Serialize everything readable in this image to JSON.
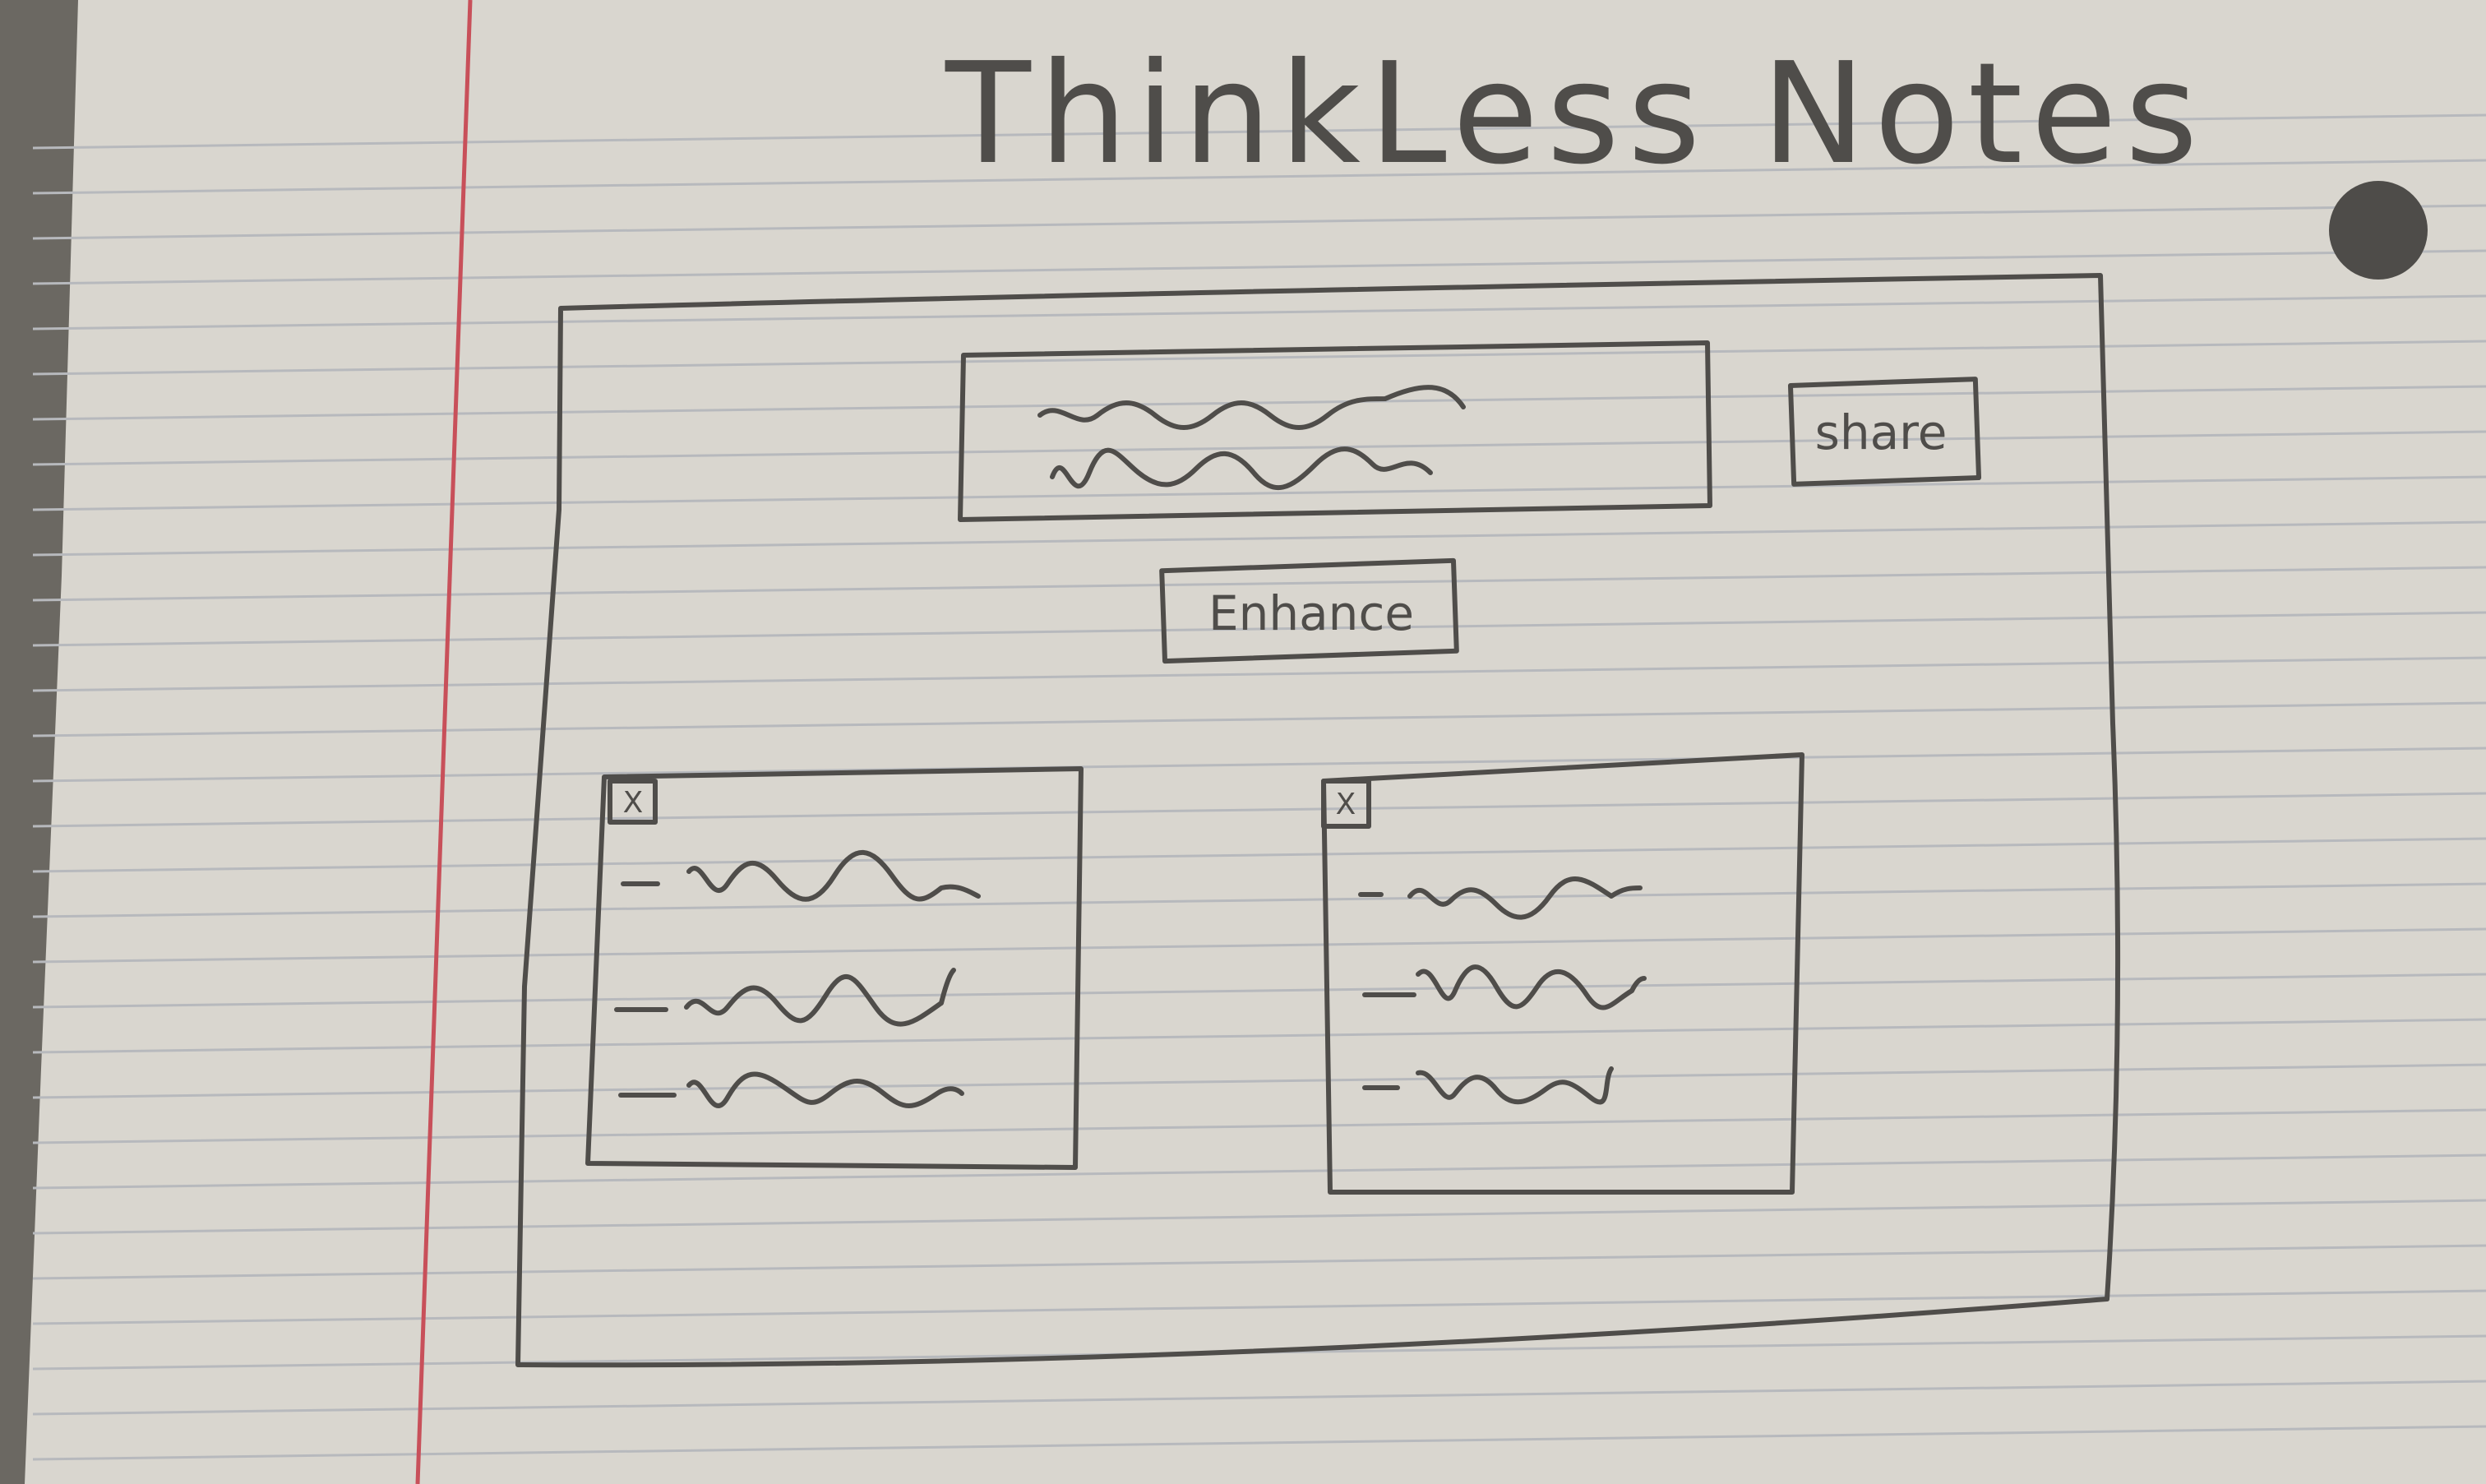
{
  "app": {
    "title": "ThinkLess Notes"
  },
  "toolbar": {
    "share_label": "share"
  },
  "actions": {
    "enhance_label": "Enhance"
  },
  "input_box": {
    "content": "scribbled-text"
  },
  "cards": [
    {
      "close_label": "X",
      "items": [
        "scribble",
        "scribble",
        "scribble"
      ]
    },
    {
      "close_label": "X",
      "items": [
        "scribble",
        "scribble",
        "scribble"
      ]
    }
  ],
  "colors": {
    "paper": "#d9d6cf",
    "ink": "#4f4d4a",
    "margin_line": "#c8505a",
    "rule_line": "#b7b9bd",
    "desk": "#6b6862"
  }
}
